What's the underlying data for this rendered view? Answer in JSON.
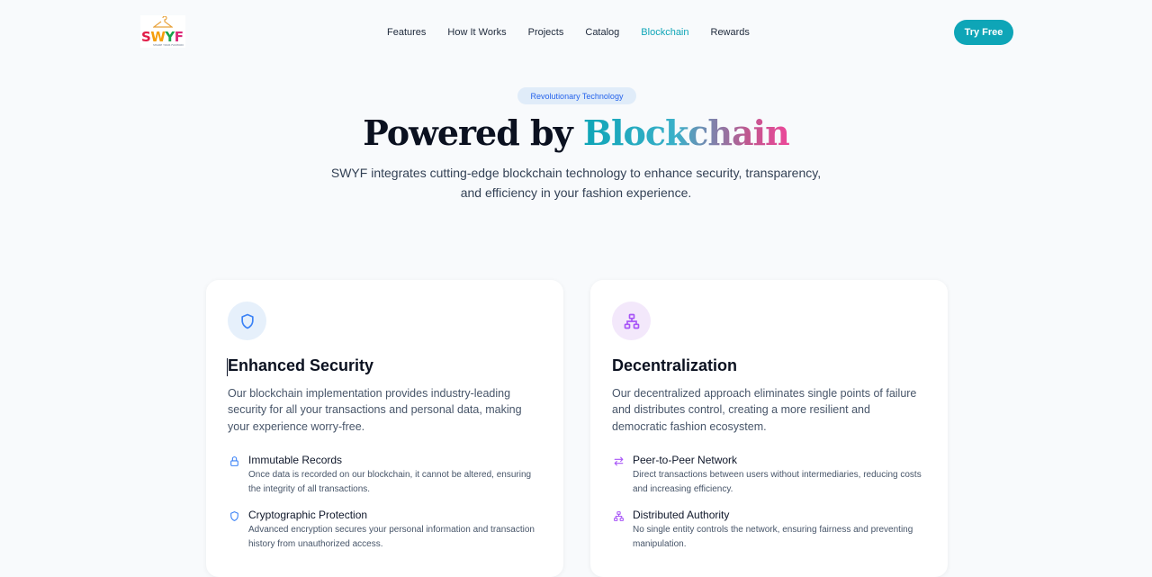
{
  "brand": {
    "logo_text": [
      "S",
      "W",
      "Y",
      "F"
    ],
    "logo_sub": "SHARE YOUR FASHION"
  },
  "nav": {
    "links": [
      "Features",
      "How It Works",
      "Projects",
      "Catalog",
      "Blockchain",
      "Rewards"
    ],
    "active": "Blockchain",
    "cta": "Try Free"
  },
  "hero": {
    "badge": "Revolutionary Technology",
    "title_plain": "Powered by ",
    "title_highlight": "Blockchain",
    "subtitle_line1": "SWYF integrates cutting-edge blockchain technology to enhance security, transparency,",
    "subtitle_line2": "and efficiency in your fashion experience."
  },
  "cards": [
    {
      "icon": "shield-icon",
      "title": "Enhanced Security",
      "description": "Our blockchain implementation provides industry-leading security for all your transactions and personal data, making your experience worry-free.",
      "features": [
        {
          "icon": "lock-icon",
          "title": "Immutable Records",
          "description": "Once data is recorded on our blockchain, it cannot be altered, ensuring the integrity of all transactions."
        },
        {
          "icon": "shield-icon",
          "title": "Cryptographic Protection",
          "description": "Advanced encryption secures your personal information and transaction history from unauthorized access."
        }
      ]
    },
    {
      "icon": "network-icon",
      "title": "Decentralization",
      "description": "Our decentralized approach eliminates single points of failure and distributes control, creating a more resilient and democratic fashion ecosystem.",
      "features": [
        {
          "icon": "arrows-exchange-icon",
          "title": "Peer-to-Peer Network",
          "description": "Direct transactions between users without intermediaries, reducing costs and increasing efficiency."
        },
        {
          "icon": "network-icon",
          "title": "Distributed Authority",
          "description": "No single entity controls the network, ensuring fairness and preventing manipulation."
        }
      ]
    }
  ],
  "colors": {
    "accent": "#0ea5b7",
    "security_icon": "#3b82f6",
    "decentral_icon": "#a855f7"
  }
}
